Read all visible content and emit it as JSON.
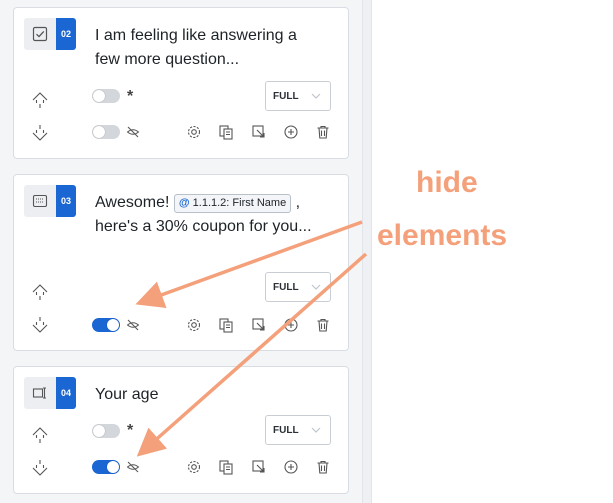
{
  "questions": [
    {
      "number": "02",
      "type_icon": "checkbox-icon",
      "text": "I am feeling like answering a few more question...",
      "required": false,
      "hidden": false,
      "width_label": "FULL"
    },
    {
      "number": "03",
      "type_icon": "message-icon",
      "text_before": "Awesome! ",
      "mention_at": "@",
      "mention_label": "1.1.1.2: First Name",
      "text_after": " , here's a 30% coupon for you...",
      "required": false,
      "hidden": true,
      "width_label": "FULL"
    },
    {
      "number": "04",
      "type_icon": "text-input-icon",
      "text": "Your age",
      "required": false,
      "hidden": true,
      "width_label": "FULL"
    }
  ],
  "required_marker": "*",
  "annotation": {
    "line1": "hide",
    "line2": "elements"
  },
  "colors": {
    "accent": "#1a66d2",
    "annotation": "#f4a07a"
  }
}
